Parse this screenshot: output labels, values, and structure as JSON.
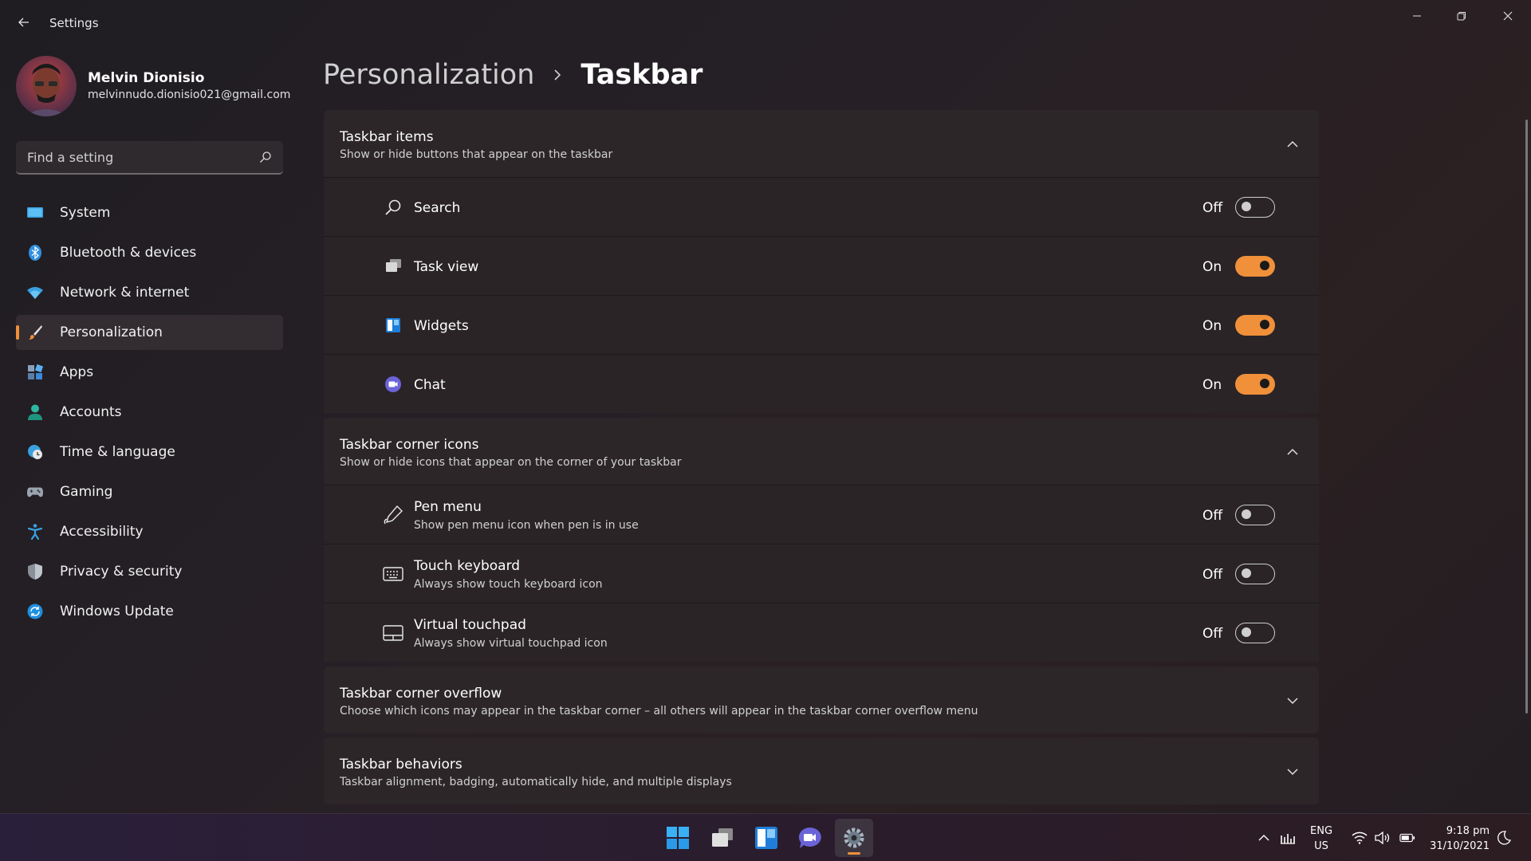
{
  "app": {
    "title": "Settings"
  },
  "user": {
    "name": "Melvin Dionisio",
    "email": "melvinnudo.dionisio021@gmail.com"
  },
  "search": {
    "placeholder": "Find a setting"
  },
  "nav": [
    {
      "label": "System",
      "icon": "monitor-icon"
    },
    {
      "label": "Bluetooth & devices",
      "icon": "bluetooth-icon"
    },
    {
      "label": "Network & internet",
      "icon": "wifi-icon"
    },
    {
      "label": "Personalization",
      "icon": "paintbrush-icon",
      "active": true
    },
    {
      "label": "Apps",
      "icon": "apps-icon"
    },
    {
      "label": "Accounts",
      "icon": "person-icon"
    },
    {
      "label": "Time & language",
      "icon": "globe-clock-icon"
    },
    {
      "label": "Gaming",
      "icon": "gamepad-icon"
    },
    {
      "label": "Accessibility",
      "icon": "accessibility-icon"
    },
    {
      "label": "Privacy & security",
      "icon": "shield-icon"
    },
    {
      "label": "Windows Update",
      "icon": "update-icon"
    }
  ],
  "breadcrumb": {
    "parent": "Personalization",
    "current": "Taskbar"
  },
  "sections": {
    "taskbar_items": {
      "title": "Taskbar items",
      "subtitle": "Show or hide buttons that appear on the taskbar",
      "items": [
        {
          "label": "Search",
          "state": "Off",
          "icon": "search-icon"
        },
        {
          "label": "Task view",
          "state": "On",
          "icon": "task-view-icon"
        },
        {
          "label": "Widgets",
          "state": "On",
          "icon": "widgets-icon"
        },
        {
          "label": "Chat",
          "state": "On",
          "icon": "chat-icon"
        }
      ]
    },
    "corner_icons": {
      "title": "Taskbar corner icons",
      "subtitle": "Show or hide icons that appear on the corner of your taskbar",
      "items": [
        {
          "label": "Pen menu",
          "desc": "Show pen menu icon when pen is in use",
          "state": "Off",
          "icon": "pen-icon"
        },
        {
          "label": "Touch keyboard",
          "desc": "Always show touch keyboard icon",
          "state": "Off",
          "icon": "keyboard-icon"
        },
        {
          "label": "Virtual touchpad",
          "desc": "Always show virtual touchpad icon",
          "state": "Off",
          "icon": "touchpad-icon"
        }
      ]
    },
    "corner_overflow": {
      "title": "Taskbar corner overflow",
      "subtitle": "Choose which icons may appear in the taskbar corner – all others will appear in the taskbar corner overflow menu"
    },
    "behaviors": {
      "title": "Taskbar behaviors",
      "subtitle": "Taskbar alignment, badging, automatically hide, and multiple displays"
    }
  },
  "taskbar": {
    "apps": [
      "start-icon",
      "task-view-icon",
      "widgets-icon",
      "chat-icon",
      "settings-icon"
    ],
    "language": "ENG",
    "region": "US",
    "time": "9:18 pm",
    "date": "31/10/2021"
  },
  "colors": {
    "accent": "#f0903a",
    "background": "#201c20"
  }
}
